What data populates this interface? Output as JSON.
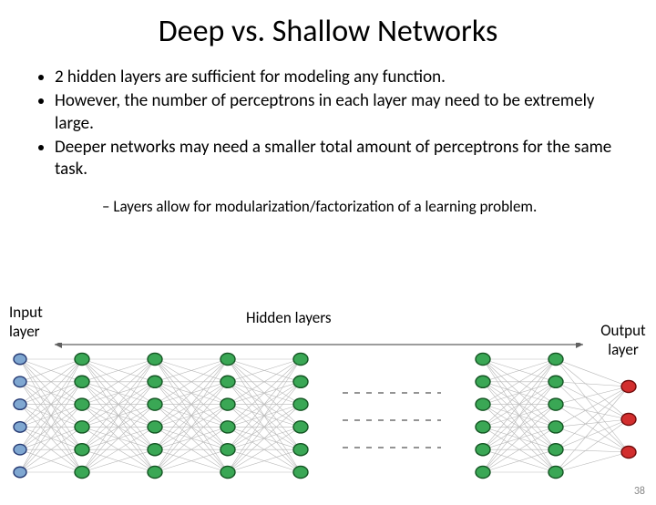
{
  "title": "Deep vs. Shallow Networks",
  "bullets": {
    "b1": "2 hidden layers are sufficient for modeling any function.",
    "b2": "However, the number of perceptrons in each layer may need to be extremely large.",
    "b3": "Deeper networks may need a smaller total amount of perceptrons for the same task."
  },
  "sub": {
    "s1": "Layers allow for modularization/factorization of a learning problem."
  },
  "labels": {
    "input": "Input layer",
    "hidden": "Hidden layers",
    "output": "Output layer"
  },
  "net": {
    "left_block_layers": 4,
    "right_block_layers": 2,
    "hidden_per_layer": 6,
    "input_nodes": 6,
    "output_nodes": 3,
    "colors": {
      "input_fill": "#7fa7d1",
      "input_stroke": "#263a73",
      "hidden_fill": "#3aa755",
      "hidden_stroke": "#145523",
      "output_fill": "#d22e2e",
      "output_stroke": "#6e0b0b",
      "edge": "#b9b9b9",
      "arrow": "#606060",
      "dash": "#555555"
    }
  },
  "pagenum": "38"
}
